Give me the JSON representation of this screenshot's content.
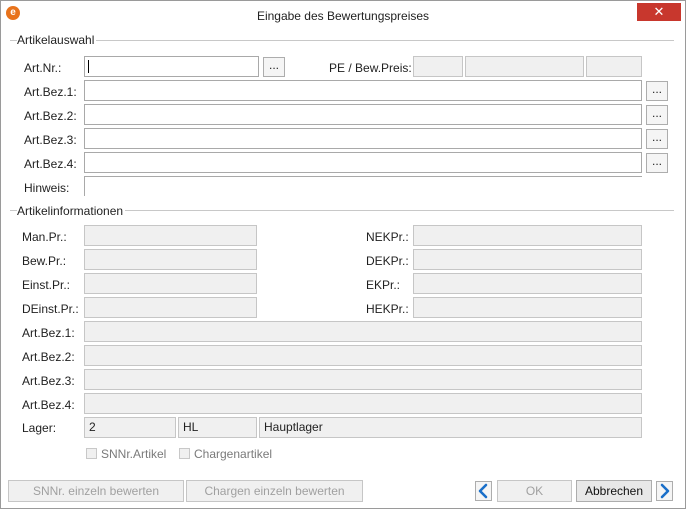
{
  "window": {
    "title": "Eingabe des Bewertungspreises",
    "close_icon": "close-icon"
  },
  "artikelauswahl": {
    "section_label": "Artikelauswahl",
    "art_nr_label": "Art.Nr.:",
    "pe_label": "PE / Bew.Preis:",
    "bez1_label": "Art.Bez.1:",
    "bez2_label": "Art.Bez.2:",
    "bez3_label": "Art.Bez.3:",
    "bez4_label": "Art.Bez.4:",
    "hinweis_label": "Hinweis:",
    "dots": "..."
  },
  "artikelinformationen": {
    "section_label": "Artikelinformationen",
    "man_pr_label": "Man.Pr.:",
    "bew_pr_label": "Bew.Pr.:",
    "einst_pr_label": "Einst.Pr.:",
    "deinst_pr_label": "DEinst.Pr.:",
    "nekpr_label": "NEKPr.:",
    "dekpr_label": "DEKPr.:",
    "ekpr_label": "EKPr.:",
    "hekpr_label": "HEKPr.:",
    "bez1_label": "Art.Bez.1:",
    "bez2_label": "Art.Bez.2:",
    "bez3_label": "Art.Bez.3:",
    "bez4_label": "Art.Bez.4:",
    "lager_label": "Lager:",
    "lager_nr": "2",
    "lager_code": "HL",
    "lager_name": "Hauptlager",
    "snnr_label": "SNNr.Artikel",
    "charge_label": "Chargenartikel"
  },
  "footer": {
    "snnr_button": "SNNr. einzeln bewerten",
    "chargen_button": "Chargen einzeln bewerten",
    "ok_button": "OK",
    "abbrechen_button": "Abbrechen"
  },
  "colors": {
    "accent": "#1a6fc9",
    "close_bg": "#c8372d",
    "readonly_bg": "#f0f0f0"
  }
}
